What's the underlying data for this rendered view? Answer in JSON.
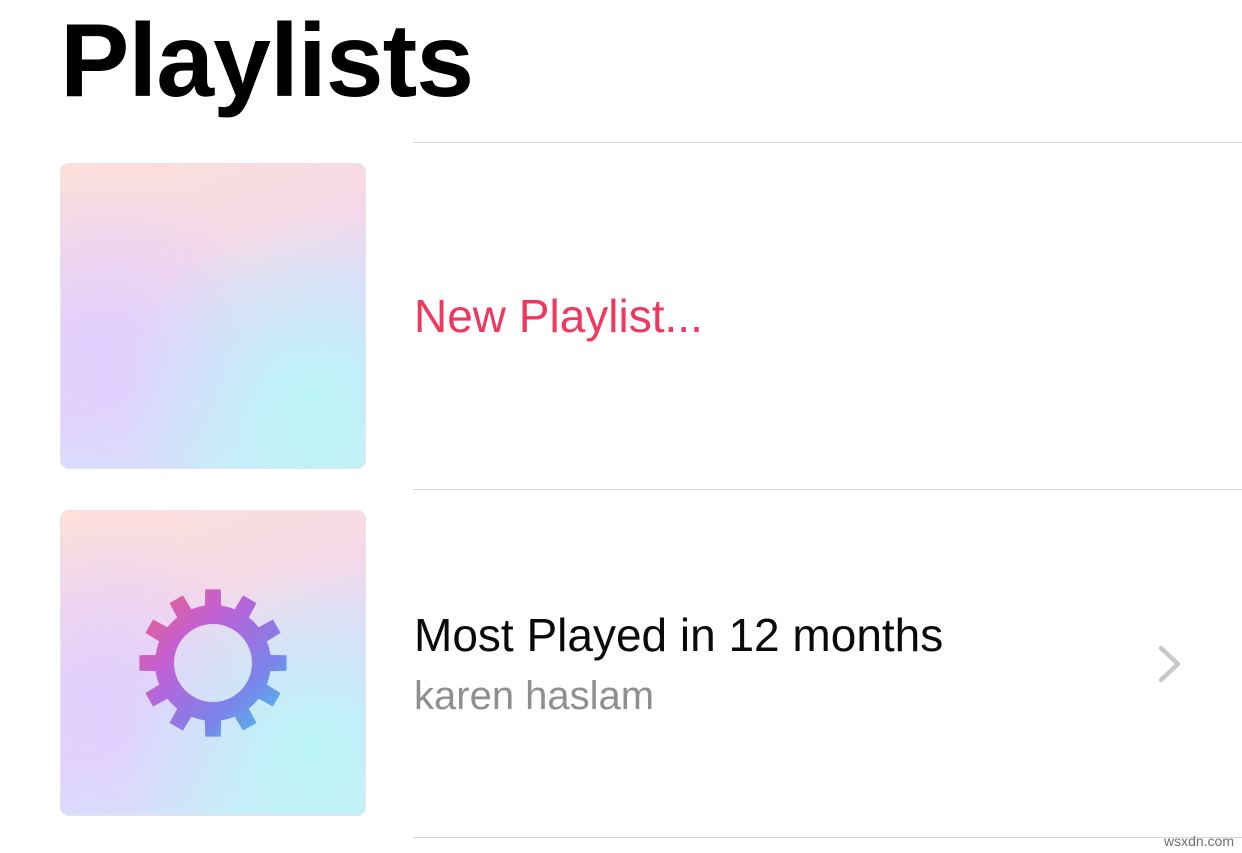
{
  "header": {
    "title": "Playlists"
  },
  "rows": [
    {
      "label": "New Playlist...",
      "icon": "plus-icon",
      "accent": "#f0385f"
    },
    {
      "title": "Most Played in 12 months",
      "subtitle": "karen haslam",
      "icon": "gear-icon",
      "trailing_icon": "chevron-right-icon"
    }
  ],
  "watermark": "wsxdn.com"
}
